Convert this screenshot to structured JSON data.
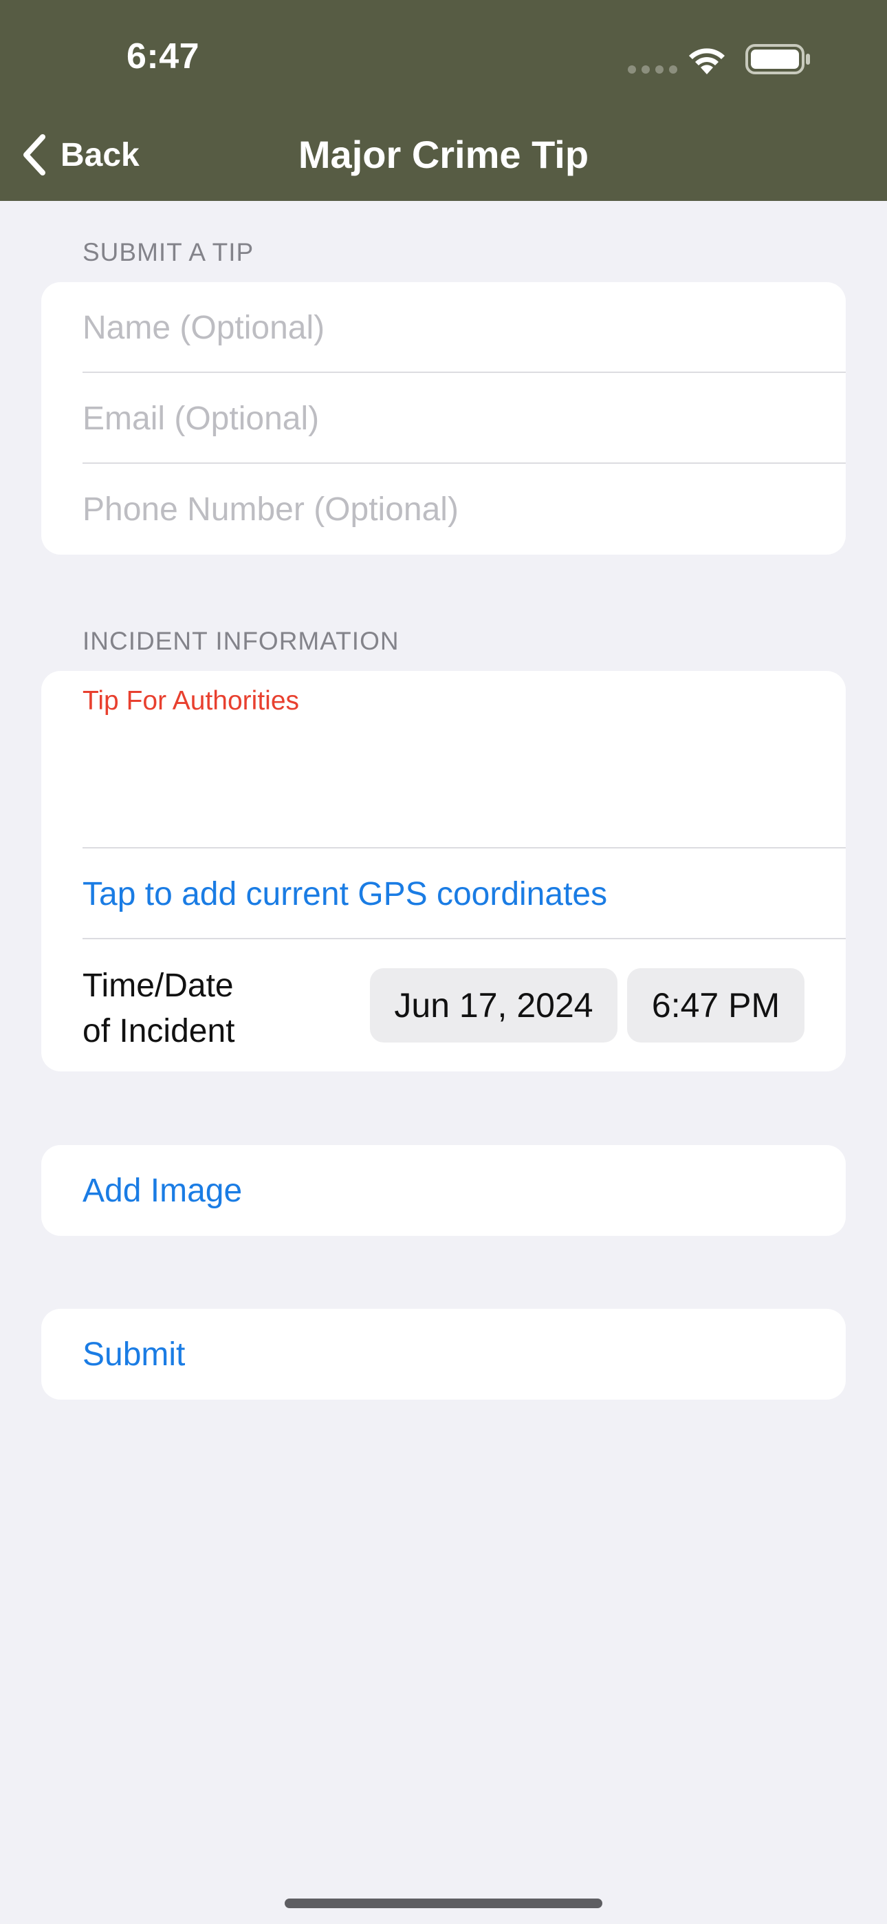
{
  "status_bar": {
    "time": "6:47"
  },
  "nav": {
    "back_label": "Back",
    "title": "Major Crime Tip"
  },
  "sections": {
    "submit_header": "SUBMIT A TIP",
    "incident_header": "INCIDENT INFORMATION"
  },
  "form": {
    "name_placeholder": "Name (Optional)",
    "email_placeholder": "Email (Optional)",
    "phone_placeholder": "Phone Number (Optional)",
    "tip_label": "Tip For Authorities",
    "gps_link": "Tap to add current GPS coordinates",
    "time_label_line1": "Time/Date",
    "time_label_line2": "of Incident",
    "date_value": "Jun 17, 2024",
    "time_value": "6:47 PM"
  },
  "actions": {
    "add_image": "Add Image",
    "submit": "Submit"
  },
  "colors": {
    "nav_bar": "#575c44",
    "accent": "#1a7ce4",
    "label_red": "#e8402f",
    "background": "#f1f1f6"
  }
}
